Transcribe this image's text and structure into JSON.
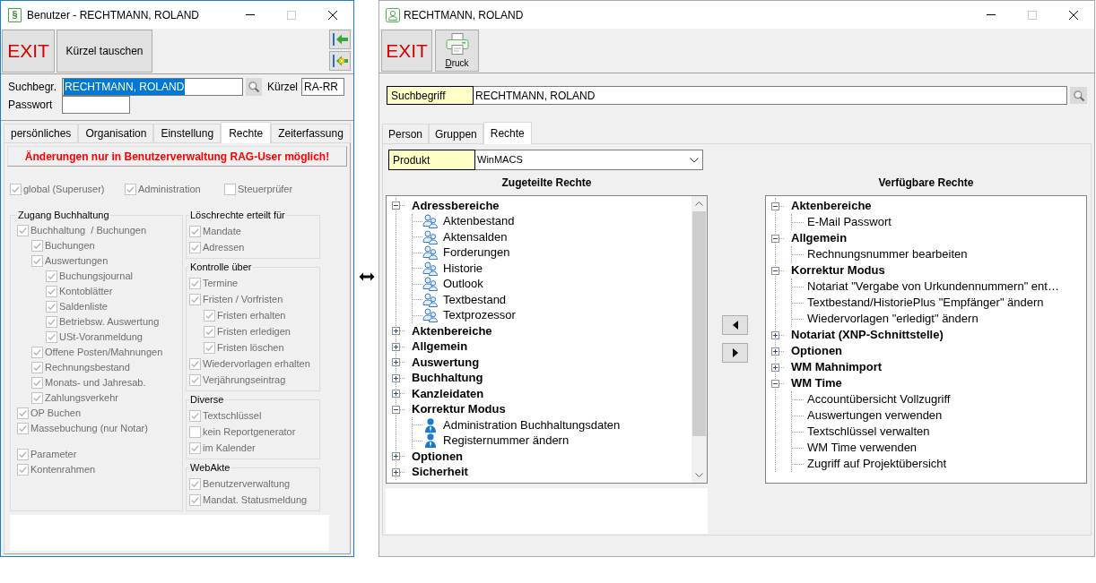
{
  "left_window": {
    "title": "Benutzer - RECHTMANN, ROLAND",
    "icon_glyph": "§",
    "maximize_disabled": true,
    "toolbar": [
      {
        "label": "EXIT",
        "kind": "exit"
      },
      {
        "label": "Kürzel tauschen",
        "kind": "text"
      }
    ],
    "search": {
      "label": "Suchbegr.",
      "value": "RECHTMANN, ROLAND",
      "text_selected": true
    },
    "short_code": {
      "label": "Kürzel",
      "value": "RA-RR"
    },
    "password": {
      "label": "Passwort"
    },
    "tabs": [
      {
        "label": "persönliches",
        "selected": false
      },
      {
        "label": "Organisation",
        "selected": false
      },
      {
        "label": "Einstellung",
        "selected": false
      },
      {
        "label": "Rechte",
        "selected": true
      },
      {
        "label": "Zeiterfassung",
        "selected": false
      }
    ],
    "notice": "Änderungen nur in Benutzerverwaltung RAG-User möglich!",
    "top_options": [
      {
        "label": "global (Superuser)",
        "checked": true,
        "disabled": true
      },
      {
        "label": "Administration",
        "checked": true,
        "disabled": true
      },
      {
        "label": "Steuerprüfer",
        "checked": false,
        "disabled": true
      }
    ],
    "columns": [
      {
        "groups": [
          {
            "title": "Zugang Buchhaltung",
            "sections": [
              {
                "items": [
                  {
                    "label": "Buchhaltung  / Buchungen",
                    "checked": true,
                    "disabled": true,
                    "children": [
                      {
                        "label": "Buchungen",
                        "checked": true,
                        "disabled": true
                      },
                      {
                        "label": "Auswertungen",
                        "checked": true,
                        "disabled": true,
                        "children": [
                          {
                            "label": "Buchungsjournal",
                            "checked": true,
                            "disabled": true
                          },
                          {
                            "label": "Kontoblätter",
                            "checked": true,
                            "disabled": true
                          },
                          {
                            "label": "Saldenliste",
                            "checked": true,
                            "disabled": true
                          },
                          {
                            "label": "Betriebsw. Auswertung",
                            "checked": true,
                            "disabled": true
                          },
                          {
                            "label": "USt-Voranmeldung",
                            "checked": true,
                            "disabled": true
                          }
                        ]
                      },
                      {
                        "label": "Offene Posten/Mahnungen",
                        "checked": true,
                        "disabled": true
                      },
                      {
                        "label": "Rechnungsbestand",
                        "checked": true,
                        "disabled": true
                      },
                      {
                        "label": "Monats- und Jahresab.",
                        "checked": true,
                        "disabled": true
                      },
                      {
                        "label": "Zahlungsverkehr",
                        "checked": true,
                        "disabled": true
                      }
                    ]
                  },
                  {
                    "label": "OP Buchen",
                    "checked": true,
                    "disabled": true
                  },
                  {
                    "label": "Massebuchung (nur Notar)",
                    "checked": true,
                    "disabled": true
                  }
                ]
              },
              {
                "items": [
                  {
                    "label": "Parameter",
                    "checked": true,
                    "disabled": true
                  },
                  {
                    "label": "Kontenrahmen",
                    "checked": true,
                    "disabled": true
                  }
                ]
              }
            ]
          }
        ]
      },
      {
        "groups": [
          {
            "title": "Löschrechte erteilt für",
            "sections": [
              {
                "items": [
                  {
                    "label": "Mandate",
                    "checked": true,
                    "disabled": true
                  },
                  {
                    "label": "Adressen",
                    "checked": true,
                    "disabled": true
                  }
                ]
              }
            ]
          },
          {
            "title": "Kontrolle über",
            "sections": [
              {
                "items": [
                  {
                    "label": "Termine",
                    "checked": true,
                    "disabled": true
                  },
                  {
                    "label": "Fristen / Vorfristen",
                    "checked": true,
                    "disabled": true,
                    "children": [
                      {
                        "label": "Fristen erhalten",
                        "checked": true,
                        "disabled": true
                      },
                      {
                        "label": "Fristen erledigen",
                        "checked": true,
                        "disabled": true
                      },
                      {
                        "label": "Fristen löschen",
                        "checked": true,
                        "disabled": true
                      }
                    ]
                  },
                  {
                    "label": "Wiedervorlagen erhalten",
                    "checked": true,
                    "disabled": true
                  },
                  {
                    "label": "Verjährungseintrag",
                    "checked": true,
                    "disabled": true
                  }
                ]
              }
            ]
          },
          {
            "title": "Diverse",
            "sections": [
              {
                "items": [
                  {
                    "label": "Textschlüssel",
                    "checked": true,
                    "disabled": true
                  },
                  {
                    "label": "kein Reportgenerator",
                    "checked": false,
                    "disabled": true
                  },
                  {
                    "label": "im Kalender",
                    "checked": true,
                    "disabled": true
                  }
                ]
              }
            ]
          },
          {
            "title": "WebAkte",
            "sections": [
              {
                "items": [
                  {
                    "label": "Benutzerverwaltung",
                    "checked": true,
                    "disabled": true
                  },
                  {
                    "label": "Mandat. Statusmeldung",
                    "checked": true,
                    "disabled": true
                  }
                ]
              }
            ]
          }
        ]
      }
    ]
  },
  "right_window": {
    "title": "RECHTMANN, ROLAND",
    "maximize_disabled": true,
    "toolbar": [
      {
        "label": "EXIT",
        "kind": "exit"
      },
      {
        "label": "Druck",
        "kind": "print"
      }
    ],
    "search": {
      "label": "Suchbegriff",
      "value": "RECHTMANN, ROLAND"
    },
    "tabs": [
      {
        "label": "Person",
        "selected": false
      },
      {
        "label": "Gruppen",
        "selected": false
      },
      {
        "label": "Rechte",
        "selected": true
      }
    ],
    "product": {
      "label": "Produkt",
      "value": "WinMACS"
    },
    "assigned_rights": {
      "title": "Zugeteilte Rechte",
      "tree": [
        {
          "label": "Adressbereiche",
          "expanded": true,
          "children": [
            {
              "label": "Aktenbestand",
              "kind": "group"
            },
            {
              "label": "Aktensalden",
              "kind": "group"
            },
            {
              "label": "Forderungen",
              "kind": "group"
            },
            {
              "label": "Historie",
              "kind": "group"
            },
            {
              "label": "Outlook",
              "kind": "group"
            },
            {
              "label": "Textbestand",
              "kind": "group"
            },
            {
              "label": "Textprozessor",
              "kind": "group"
            }
          ]
        },
        {
          "label": "Aktenbereiche",
          "expanded": false
        },
        {
          "label": "Allgemein",
          "expanded": false
        },
        {
          "label": "Auswertung",
          "expanded": false
        },
        {
          "label": "Buchhaltung",
          "expanded": false
        },
        {
          "label": "Kanzleidaten",
          "expanded": false
        },
        {
          "label": "Korrektur Modus",
          "expanded": true,
          "children": [
            {
              "label": "Administration Buchhaltungsdaten",
              "kind": "person"
            },
            {
              "label": "Registernummer ändern",
              "kind": "person"
            }
          ]
        },
        {
          "label": "Optionen",
          "expanded": false
        },
        {
          "label": "Sicherheit",
          "expanded": false
        }
      ]
    },
    "available_rights": {
      "title": "Verfügbare Rechte",
      "tree": [
        {
          "label": "Aktenbereiche",
          "expanded": true,
          "children": [
            {
              "label": "E-Mail Passwort",
              "kind": "plain"
            }
          ]
        },
        {
          "label": "Allgemein",
          "expanded": true,
          "children": [
            {
              "label": "Rechnungsnummer bearbeiten",
              "kind": "plain"
            }
          ]
        },
        {
          "label": "Korrektur Modus",
          "expanded": true,
          "children": [
            {
              "label": "Notariat \"Vergabe von Urkundennummern\" ent…",
              "kind": "plain"
            },
            {
              "label": "Textbestand/HistoriePlus \"Empfänger\" ändern",
              "kind": "plain"
            },
            {
              "label": "Wiedervorlagen \"erledigt\" ändern",
              "kind": "plain"
            }
          ]
        },
        {
          "label": "Notariat (XNP-Schnittstelle)",
          "expanded": false
        },
        {
          "label": "Optionen",
          "expanded": false
        },
        {
          "label": "WM Mahnimport",
          "expanded": false
        },
        {
          "label": "WM Time",
          "expanded": true,
          "children": [
            {
              "label": "Accountübersicht Vollzugriff",
              "kind": "plain"
            },
            {
              "label": "Auswertungen verwenden",
              "kind": "plain"
            },
            {
              "label": "Textschlüssel verwalten",
              "kind": "plain"
            },
            {
              "label": "WM Time verwenden",
              "kind": "plain"
            },
            {
              "label": "Zugriff auf Projektübersicht",
              "kind": "plain"
            }
          ]
        }
      ]
    }
  }
}
